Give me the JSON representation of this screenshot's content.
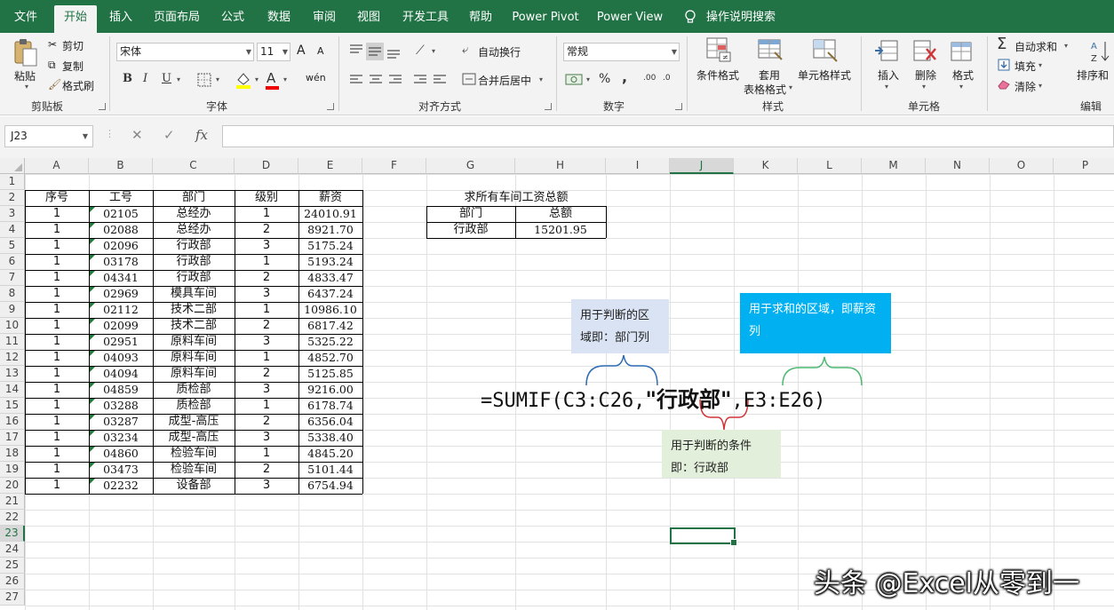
{
  "tabs": [
    {
      "label": "文件"
    },
    {
      "label": "开始"
    },
    {
      "label": "插入"
    },
    {
      "label": "页面布局"
    },
    {
      "label": "公式"
    },
    {
      "label": "数据"
    },
    {
      "label": "审阅"
    },
    {
      "label": "视图"
    },
    {
      "label": "开发工具"
    },
    {
      "label": "帮助"
    },
    {
      "label": "Power Pivot"
    },
    {
      "label": "Power View"
    }
  ],
  "tell_me": "操作说明搜索",
  "ribbon": {
    "clipboard": {
      "paste": "粘贴",
      "cut": "剪切",
      "copy": "复制",
      "painter": "格式刷",
      "group": "剪贴板"
    },
    "font": {
      "name": "宋体",
      "size": "11",
      "grow": "A",
      "shrink": "A",
      "bold": "B",
      "italic": "I",
      "underline": "U",
      "wen": "wén",
      "group": "字体",
      "font_color": "A"
    },
    "alignment": {
      "wrap": "自动换行",
      "merge": "合并后居中",
      "group": "对齐方式"
    },
    "number": {
      "format": "常规",
      "percent": "%",
      "comma": ",",
      "group": "数字"
    },
    "styles": {
      "conditional": "条件格式",
      "table1": "套用",
      "table2": "表格格式",
      "cell_styles": "单元格样式",
      "group": "样式"
    },
    "cells": {
      "insert": "插入",
      "delete": "删除",
      "format": "格式",
      "group": "单元格"
    },
    "editing": {
      "autosum": "自动求和",
      "fill": "填充",
      "clear": "清除",
      "sort": "排序和",
      "group": "编辑"
    }
  },
  "formula_bar": {
    "name_box": "J23",
    "cancel": "✕",
    "enter": "✓",
    "fx": "fx",
    "value": ""
  },
  "columns": [
    "A",
    "B",
    "C",
    "D",
    "E",
    "F",
    "G",
    "H",
    "I",
    "J",
    "K",
    "L",
    "M",
    "N",
    "O",
    "P"
  ],
  "rows": [
    "1",
    "2",
    "3",
    "4",
    "5",
    "6",
    "7",
    "8",
    "9",
    "10",
    "11",
    "12",
    "13",
    "14",
    "15",
    "16",
    "17",
    "18",
    "19",
    "20",
    "21",
    "22",
    "23",
    "24",
    "25",
    "26",
    "27"
  ],
  "table": {
    "headers": [
      "序号",
      "工号",
      "部门",
      "级别",
      "薪资"
    ],
    "rows": [
      [
        "1",
        "02105",
        "总经办",
        "1",
        "24010.91"
      ],
      [
        "1",
        "02088",
        "总经办",
        "2",
        "8921.70"
      ],
      [
        "1",
        "02096",
        "行政部",
        "3",
        "5175.24"
      ],
      [
        "1",
        "03178",
        "行政部",
        "1",
        "5193.24"
      ],
      [
        "1",
        "04341",
        "行政部",
        "2",
        "4833.47"
      ],
      [
        "1",
        "02969",
        "模具车间",
        "3",
        "6437.24"
      ],
      [
        "1",
        "02112",
        "技术二部",
        "1",
        "10986.10"
      ],
      [
        "1",
        "02099",
        "技术二部",
        "2",
        "6817.42"
      ],
      [
        "1",
        "02951",
        "原料车间",
        "3",
        "5325.22"
      ],
      [
        "1",
        "04093",
        "原料车间",
        "1",
        "4852.70"
      ],
      [
        "1",
        "04094",
        "原料车间",
        "2",
        "5125.85"
      ],
      [
        "1",
        "04859",
        "质检部",
        "3",
        "9216.00"
      ],
      [
        "1",
        "03288",
        "质检部",
        "1",
        "6178.74"
      ],
      [
        "1",
        "03287",
        "成型-高压",
        "2",
        "6356.04"
      ],
      [
        "1",
        "03234",
        "成型-高压",
        "3",
        "5338.40"
      ],
      [
        "1",
        "04860",
        "检验车间",
        "1",
        "4845.20"
      ],
      [
        "1",
        "03473",
        "检验车间",
        "2",
        "5101.44"
      ],
      [
        "1",
        "02232",
        "设备部",
        "3",
        "6754.94"
      ]
    ]
  },
  "summary": {
    "title": "求所有车间工资总额",
    "col1": "部门",
    "col2": "总额",
    "dept": "行政部",
    "total": "15201.95"
  },
  "callouts": {
    "range": "用于判断的区域即：部门列",
    "sum_range": "用于求和的区域，即薪资列",
    "criteria": "用于判断的条件即：行政部"
  },
  "formula": {
    "prefix": "=SUMIF(C3:C26,",
    "criteria": "\"行政部\"",
    "suffix": ",E3:E26)"
  },
  "watermark": "头条 @Excel从零到一",
  "colors": {
    "excel_green": "#217346",
    "callout_blue": "#dae3f3",
    "callout_cyan": "#00b0f0",
    "callout_green": "#e2efda"
  }
}
